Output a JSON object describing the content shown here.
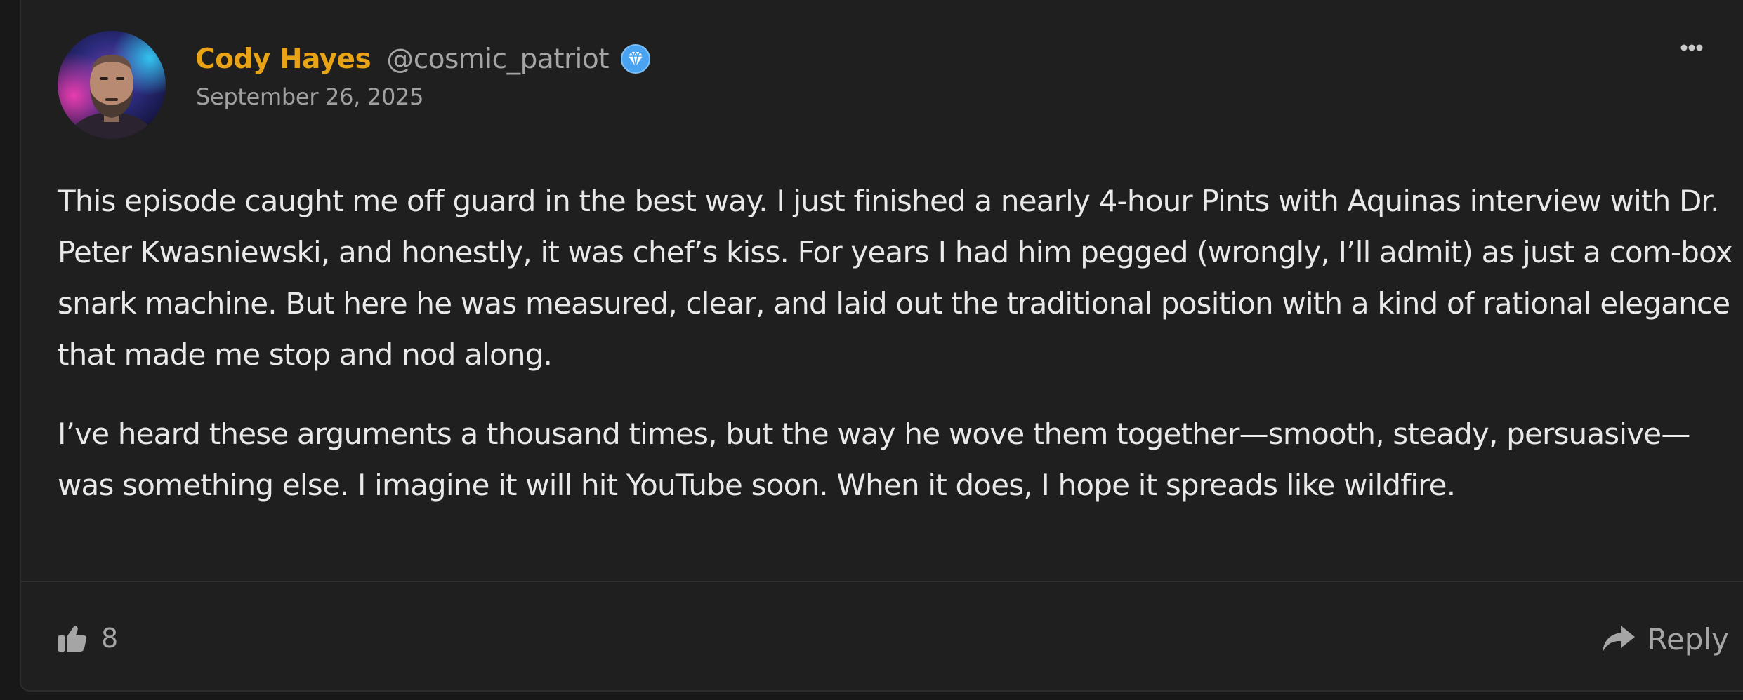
{
  "post": {
    "author": {
      "name": "Cody Hayes",
      "handle": "@cosmic_patriot",
      "badge_icon": "diamond-icon",
      "avatar_icon": "avatar-portrait"
    },
    "date": "September 26, 2025",
    "paragraphs": [
      "This episode caught me off guard in the best way. I just finished a nearly 4-hour Pints with Aquinas interview with Dr. Peter Kwasniewski, and honestly, it was chef’s kiss. For years I had him pegged (wrongly, I’ll admit) as just a com-box snark machine. But here he was measured, clear, and laid out the traditional position with a kind of rational elegance that made me stop and nod along.",
      "I’ve heard these arguments a thousand times, but the way he wove them together—smooth, steady, persuasive—was something else. I imagine it will hit YouTube soon. When it does, I hope it spreads like wildfire."
    ],
    "likes": "8",
    "reply_label": "Reply",
    "more_icon": "ellipsis-icon"
  },
  "colors": {
    "background": "#181818",
    "card": "#1f1f1f",
    "author_name": "#e8a317",
    "muted_text": "#a5a5a5",
    "body_text": "#e9e9e9",
    "badge": "#4aa3f0"
  }
}
